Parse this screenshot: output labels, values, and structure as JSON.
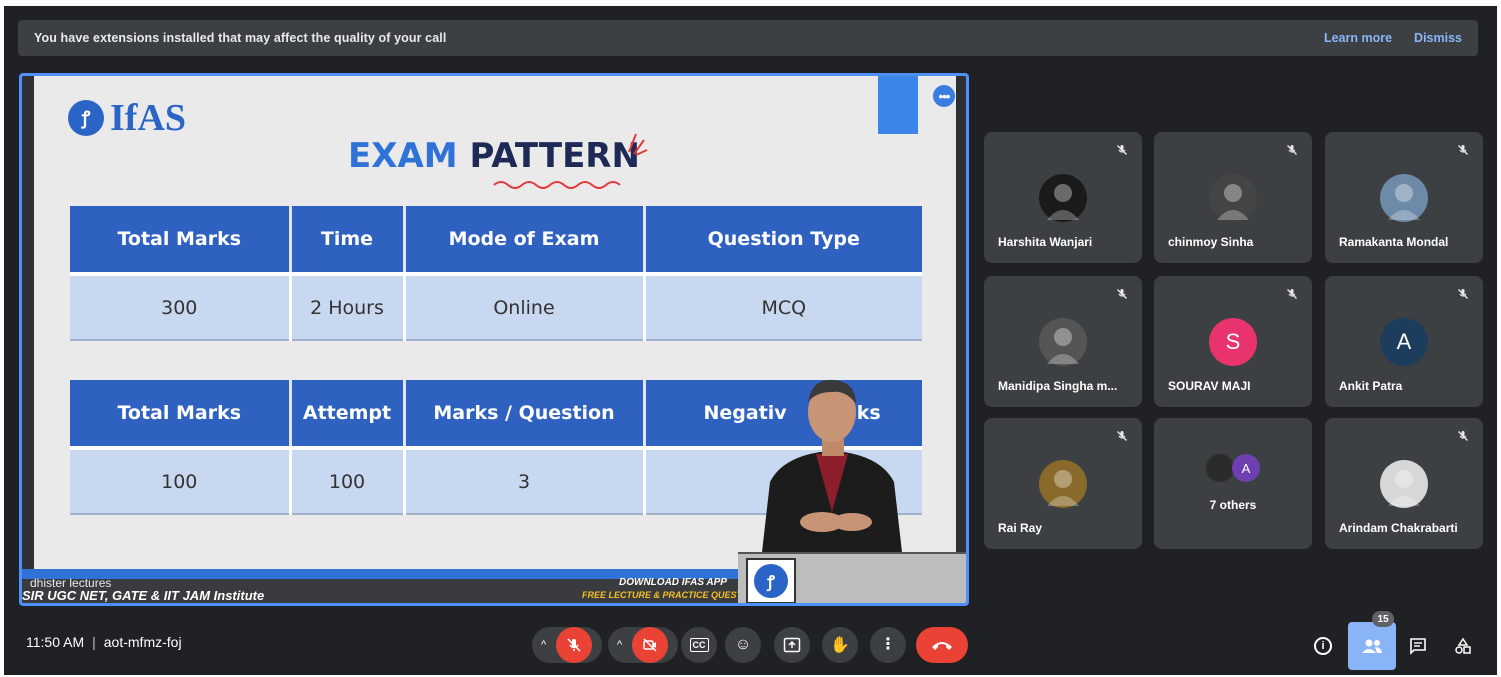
{
  "banner": {
    "message": "You have extensions installed that may affect the quality of your call",
    "learn_more": "Learn more",
    "dismiss": "Dismiss"
  },
  "slide": {
    "logo_text": "IfAS",
    "title_part1": "EXAM",
    "title_part2": "PATTERN",
    "table1": {
      "headers": [
        "Total Marks",
        "Time",
        "Mode of Exam",
        "Question Type"
      ],
      "row": [
        "300",
        "2 Hours",
        "Online",
        "MCQ"
      ]
    },
    "table2": {
      "headers": [
        "Total Marks",
        "Attempt",
        "Marks / Question",
        "Negativ",
        "ks"
      ],
      "row": [
        "100",
        "100",
        "3"
      ]
    },
    "presenter_label": "dhister lectures",
    "footer_tagline": "SIR UGC NET, GATE & IIT JAM Institute",
    "footer_app_line1": "DOWNLOAD IFAS APP",
    "footer_app_line2": "FREE LECTURE & PRACTICE QUESTIONS"
  },
  "participants": [
    {
      "name": "Harshita Wanjari",
      "avatar": "photo",
      "color": "#1b1b1b"
    },
    {
      "name": "chinmoy Sinha",
      "avatar": "photo",
      "color": "#444444"
    },
    {
      "name": "Ramakanta Mondal",
      "avatar": "photo",
      "color": "#6d8aa8"
    },
    {
      "name": "Manidipa Singha m...",
      "avatar": "photo",
      "color": "#555555"
    },
    {
      "name": "SOURAV MAJI",
      "avatar": "S",
      "color": "#e8336d"
    },
    {
      "name": "Ankit Patra",
      "avatar": "A",
      "color": "#1c3d5c"
    },
    {
      "name": "Rai Ray",
      "avatar": "photo",
      "color": "#8a6a2a"
    },
    {
      "name": "7 others",
      "avatar": "A",
      "color": "#6e3fb0"
    },
    {
      "name": "Arindam Chakrabarti",
      "avatar": "photo",
      "color": "#d7d7d7"
    }
  ],
  "bottom_bar": {
    "time": "11:50 AM",
    "meeting_code": "aot-mfmz-foj",
    "participant_count": "15"
  },
  "colors": {
    "background": "#202124",
    "tile": "#3c4043",
    "accent": "#8ab4f8",
    "end_call": "#ea4335",
    "slide_blue": "#2f62c0"
  }
}
